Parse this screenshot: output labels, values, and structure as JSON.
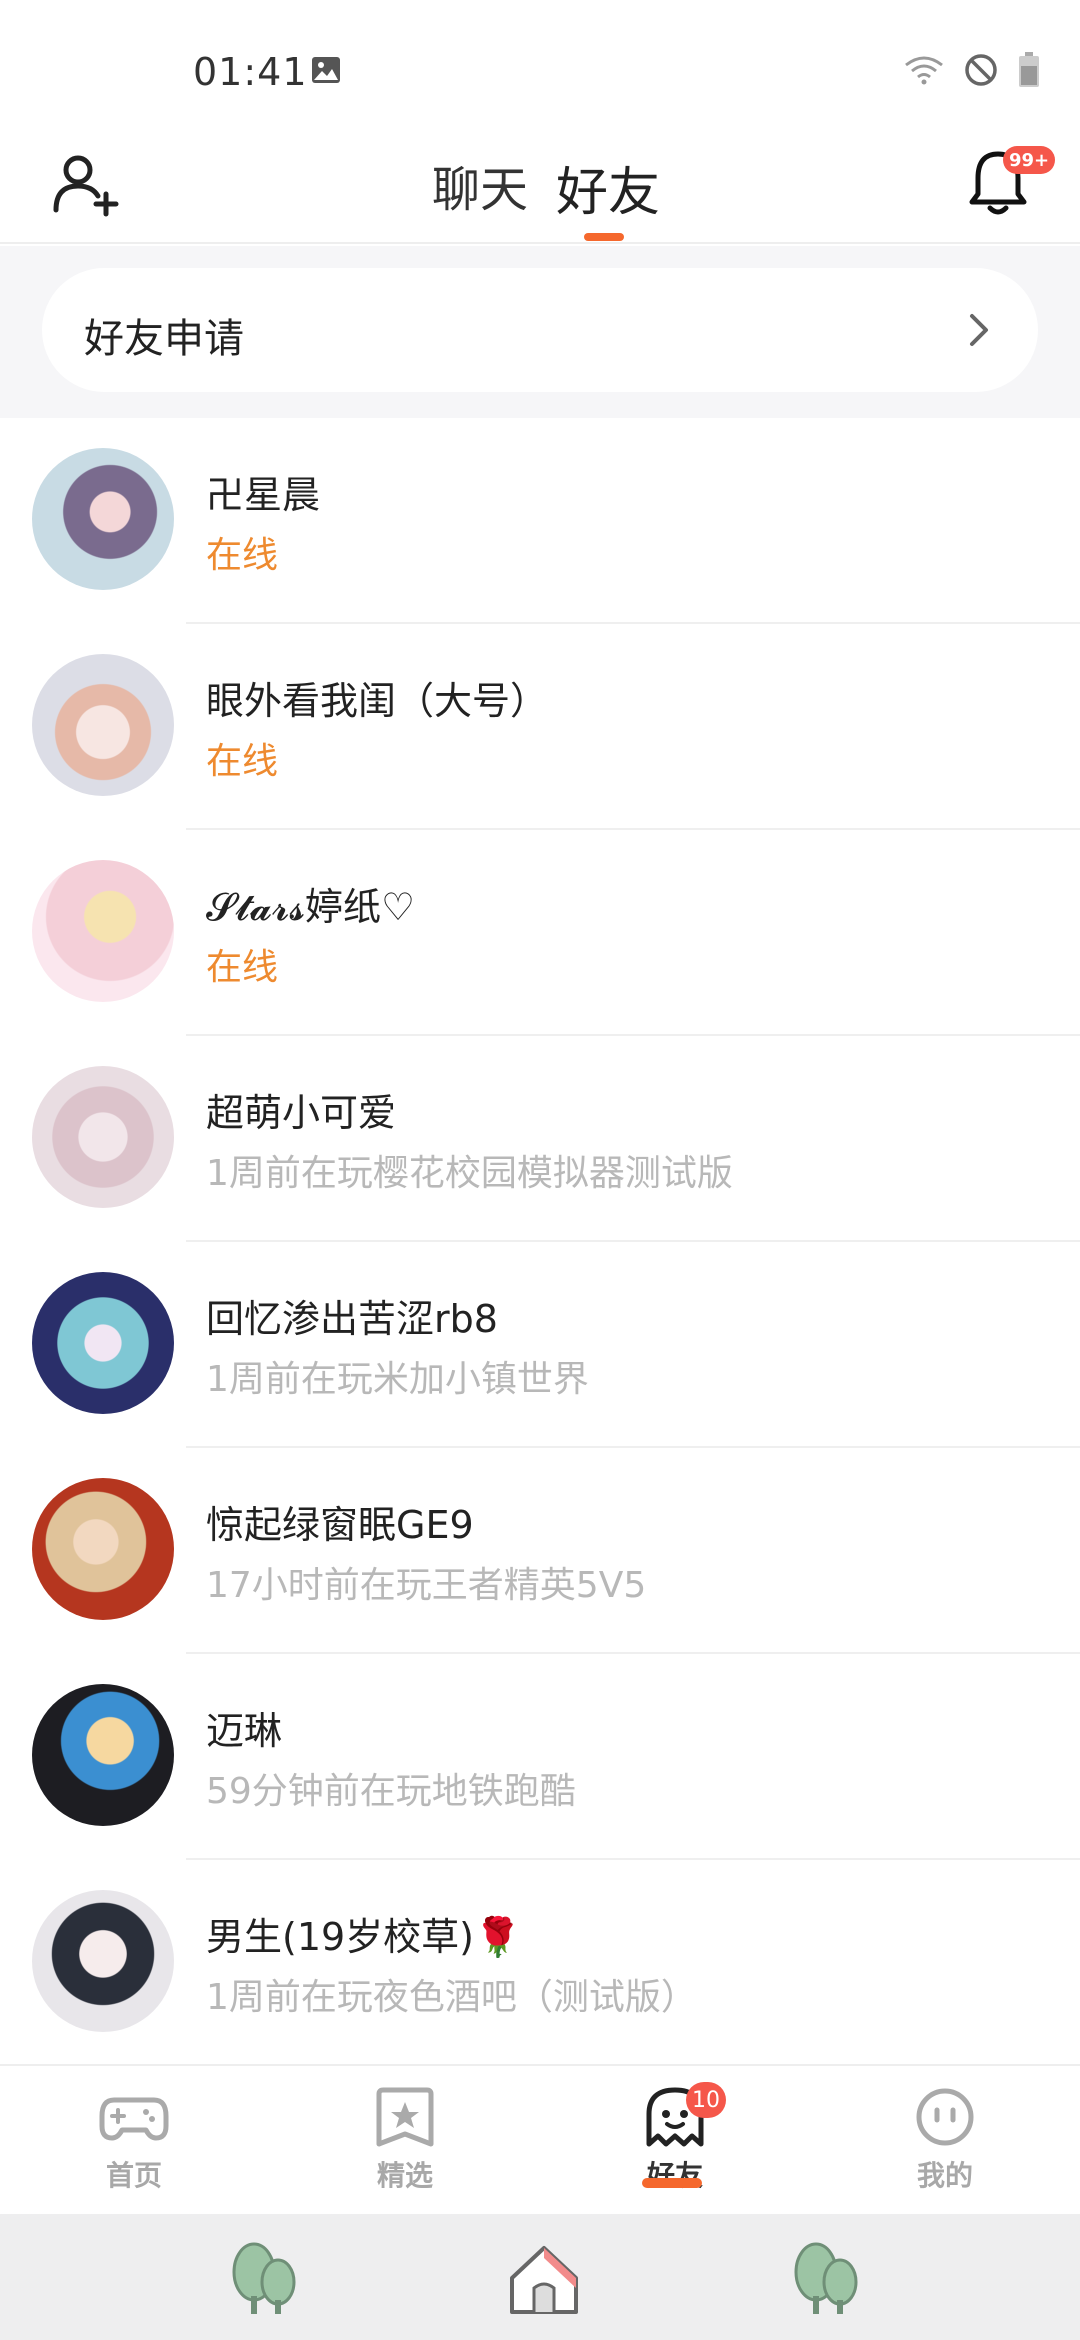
{
  "status_bar": {
    "time": "01:41",
    "icons": [
      "image-icon",
      "wifi-icon",
      "dnd-icon",
      "battery-icon"
    ]
  },
  "header": {
    "tabs": [
      {
        "label": "聊天",
        "active": false
      },
      {
        "label": "好友",
        "active": true
      }
    ],
    "notification_badge": "99+"
  },
  "friend_request": {
    "label": "好友申请"
  },
  "friends": [
    {
      "name": "卍星晨",
      "status": "在线",
      "online": true
    },
    {
      "name": "眼外看我闺（大号）",
      "status": "在线",
      "online": true
    },
    {
      "name": "𝓢𝓽𝓪𝓻𝓼婷纸♡",
      "status": "在线",
      "online": true
    },
    {
      "name": "超萌小可爱",
      "status": "1周前在玩樱花校园模拟器测试版",
      "online": false
    },
    {
      "name": "回忆渗出苦涩rb8",
      "status": "1周前在玩米加小镇世界",
      "online": false
    },
    {
      "name": "惊起绿窗眠GE9",
      "status": "17小时前在玩王者精英5V5",
      "online": false
    },
    {
      "name": "迈琳",
      "status": "59分钟前在玩地铁跑酷",
      "online": false
    },
    {
      "name": "男生(19岁校草)🌹",
      "status": "1周前在玩夜色酒吧（测试版）",
      "online": false
    }
  ],
  "bottom_nav": {
    "items": [
      {
        "label": "首页",
        "icon": "gamepad-icon",
        "active": false
      },
      {
        "label": "精选",
        "icon": "star-badge-icon",
        "active": false
      },
      {
        "label": "好友",
        "icon": "ghost-icon",
        "active": true
      },
      {
        "label": "我的",
        "icon": "face-icon",
        "active": false
      }
    ],
    "friends_badge": "10"
  },
  "colors": {
    "accent": "#f5682d",
    "online": "#ee8a2f",
    "badge": "#f5574a"
  }
}
